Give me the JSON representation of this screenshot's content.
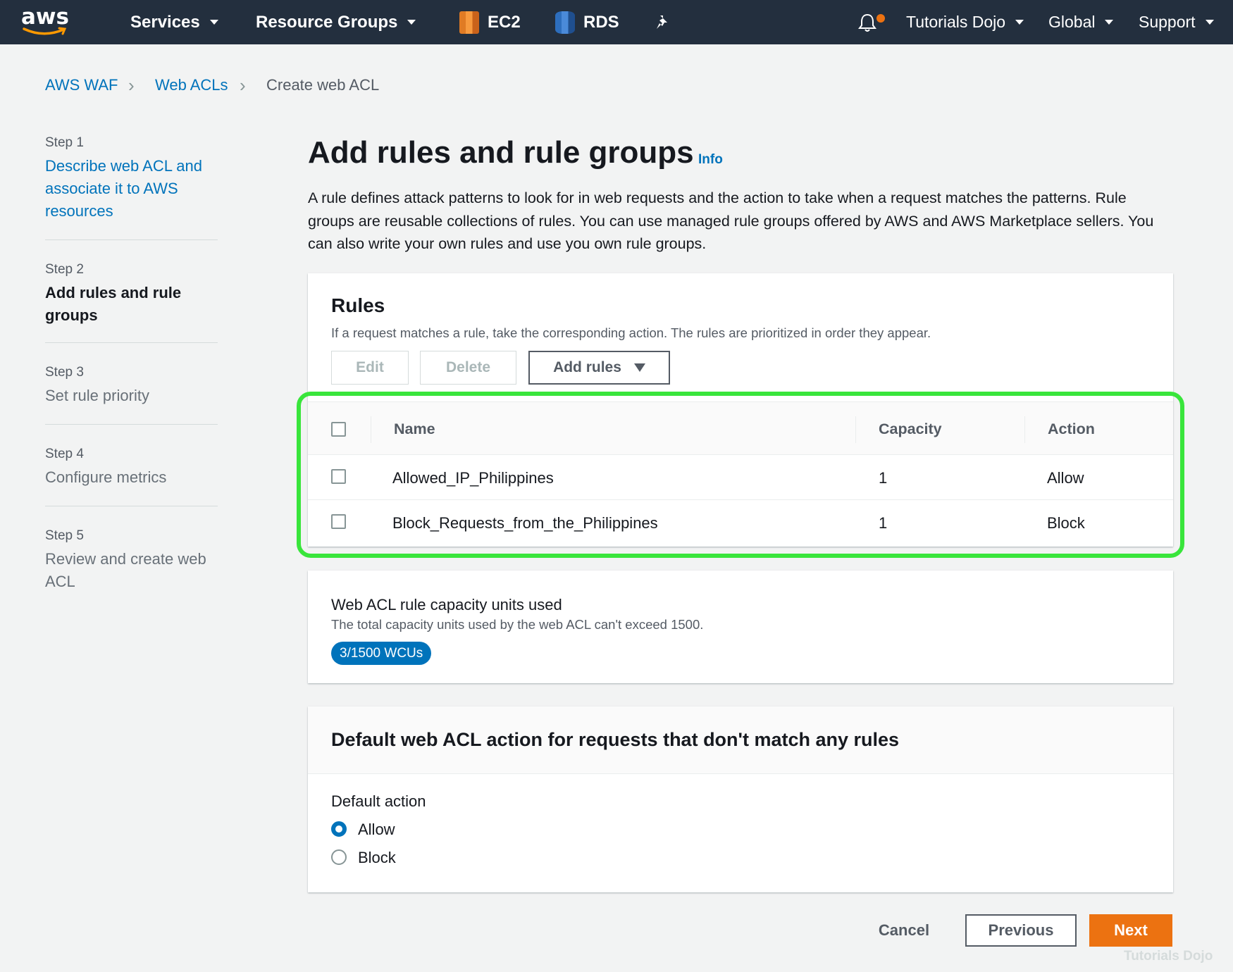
{
  "nav": {
    "logo": "aws",
    "services": "Services",
    "resource_groups": "Resource Groups",
    "ec2": "EC2",
    "rds": "RDS",
    "pin_icon": "pin-icon",
    "bell_icon": "bell-icon",
    "account": "Tutorials Dojo",
    "region": "Global",
    "support": "Support",
    "notification_dot_color": "#ec7211"
  },
  "breadcrumb": {
    "items": [
      "AWS WAF",
      "Web ACLs",
      "Create web ACL"
    ]
  },
  "steps": [
    {
      "num": "Step 1",
      "title": "Describe web ACL and associate it to AWS resources",
      "state": "link"
    },
    {
      "num": "Step 2",
      "title": "Add rules and rule groups",
      "state": "active"
    },
    {
      "num": "Step 3",
      "title": "Set rule priority",
      "state": "disabled"
    },
    {
      "num": "Step 4",
      "title": "Configure metrics",
      "state": "disabled"
    },
    {
      "num": "Step 5",
      "title": "Review and create web ACL",
      "state": "disabled"
    }
  ],
  "main": {
    "title": "Add rules and rule groups",
    "info": "Info",
    "intro": "A rule defines attack patterns to look for in web requests and the action to take when a request matches the patterns. Rule groups are reusable collections of rules. You can use managed rule groups offered by AWS and AWS Marketplace sellers. You can also write your own rules and use you own rule groups."
  },
  "rules": {
    "title": "Rules",
    "description": "If a request matches a rule, take the corresponding action. The rules are prioritized in order they appear.",
    "edit": "Edit",
    "delete": "Delete",
    "add_rules": "Add rules",
    "columns": [
      "Name",
      "Capacity",
      "Action"
    ],
    "rows": [
      {
        "name": "Allowed_IP_Philippines",
        "capacity": "1",
        "action": "Allow"
      },
      {
        "name": "Block_Requests_from_the_Philippines",
        "capacity": "1",
        "action": "Block"
      }
    ],
    "highlight_color": "#39e53b"
  },
  "capacity": {
    "title": "Web ACL rule capacity units used",
    "description": "The total capacity units used by the web ACL can't exceed 1500.",
    "badge": "3/1500 WCUs"
  },
  "default_action": {
    "title": "Default web ACL action for requests that don't match any rules",
    "label": "Default action",
    "options": [
      "Allow",
      "Block"
    ],
    "selected": "Allow"
  },
  "footer": {
    "cancel": "Cancel",
    "previous": "Previous",
    "next": "Next",
    "watermark": "Tutorials Dojo",
    "accent": "#ec7211"
  }
}
